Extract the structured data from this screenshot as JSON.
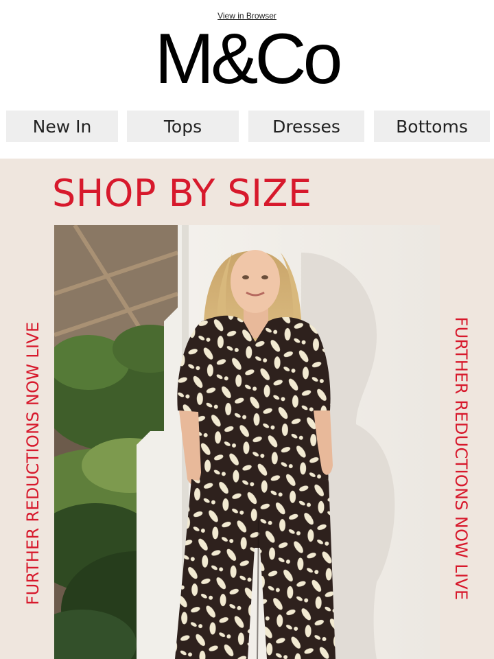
{
  "header": {
    "view_in_browser": "View in Browser",
    "logo_text": "M&Co"
  },
  "nav": {
    "items": [
      {
        "label": "New In"
      },
      {
        "label": "Tops"
      },
      {
        "label": "Dresses"
      },
      {
        "label": "Bottoms"
      }
    ]
  },
  "hero": {
    "title": "SHOP BY SIZE",
    "side_text_left": "FURTHER REDUCTIONS NOW LIVE",
    "side_text_right": "FURTHER REDUCTIONS NOW LIVE",
    "photo_name": "model-floral-coord-photo"
  },
  "colors": {
    "accent_red": "#d7192c",
    "hero_background": "#efe6de",
    "nav_background": "#eeeeee",
    "outfit_dark": "#2e211d",
    "outfit_print": "#f2ead2"
  }
}
